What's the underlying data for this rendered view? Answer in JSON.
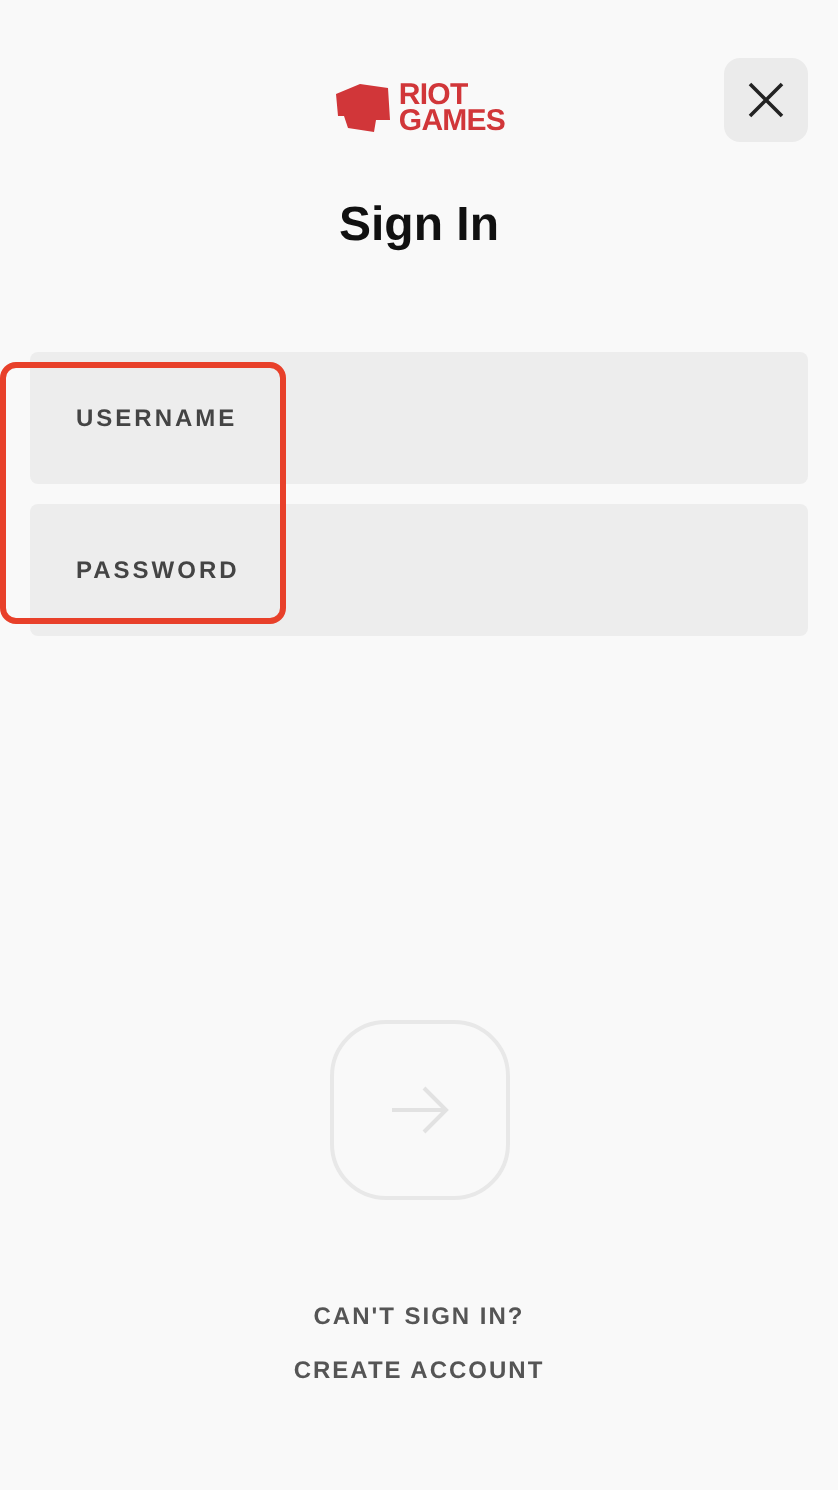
{
  "logo": {
    "line1": "RIOT",
    "line2": "GAMES"
  },
  "title": "Sign In",
  "fields": [
    {
      "label": "USERNAME"
    },
    {
      "label": "PASSWORD"
    }
  ],
  "fields_highlighted": true,
  "submit": {
    "disabled": true
  },
  "links": [
    "CAN'T SIGN IN?",
    "CREATE ACCOUNT"
  ]
}
